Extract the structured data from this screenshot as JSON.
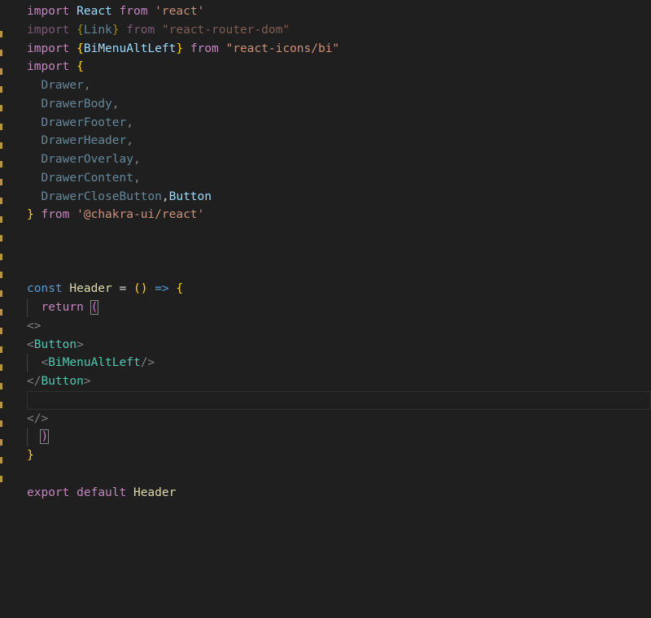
{
  "editor": {
    "colors": {
      "background": "#1f1f1f",
      "keyword_import": "#c586c0",
      "identifier": "#9cdcfe",
      "string": "#ce9178",
      "brace_gold": "#ffd700",
      "brace_violet": "#da70d6",
      "jsx_tag": "#4ec9b0",
      "storage_keyword": "#569cd6",
      "function_name": "#dcdcaa"
    },
    "lines": {
      "l1": {
        "kw": "import",
        "id": "React",
        "from": "from",
        "str": "'react'"
      },
      "l2": {
        "kw": "import",
        "open": "{",
        "id": "Link",
        "close": "}",
        "from": "from",
        "str": "\"react-router-dom\""
      },
      "l3": {
        "kw": "import",
        "open": "{",
        "id": "BiMenuAltLeft",
        "close": "}",
        "from": "from",
        "str": "\"react-icons/bi\""
      },
      "l4": {
        "kw": "import",
        "open": "{"
      },
      "l5": {
        "id": "Drawer",
        "punct": ","
      },
      "l6": {
        "id": "DrawerBody",
        "punct": ","
      },
      "l7": {
        "id": "DrawerFooter",
        "punct": ","
      },
      "l8": {
        "id": "DrawerHeader",
        "punct": ","
      },
      "l9": {
        "id": "DrawerOverlay",
        "punct": ","
      },
      "l10": {
        "id": "DrawerContent",
        "punct": ","
      },
      "l11": {
        "id": "DrawerCloseButton",
        "punct": ",",
        "id2": "Button"
      },
      "l12": {
        "close": "}",
        "from": "from",
        "str": "'@chakra-ui/react'"
      },
      "l16": {
        "kw": "const",
        "name": "Header",
        "eq": "=",
        "parens": "()",
        "arrow": "=>",
        "open": "{"
      },
      "l17": {
        "kw": "return",
        "paren": "("
      },
      "l18": {
        "frag": "<>"
      },
      "l19": {
        "lt": "<",
        "tag": "Button",
        "gt": ">"
      },
      "l20": {
        "lt": "<",
        "tag": "BiMenuAltLeft",
        "end": "/>"
      },
      "l21": {
        "lt": "</",
        "tag": "Button",
        "gt": ">"
      },
      "l23": {
        "frag": "</>"
      },
      "l24": {
        "paren": ")"
      },
      "l25": {
        "close": "}"
      },
      "l27": {
        "kw": "export",
        "kw2": "default",
        "name": "Header"
      }
    }
  }
}
